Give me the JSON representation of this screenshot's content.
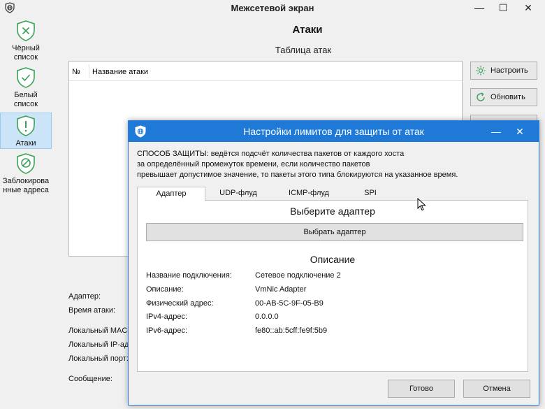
{
  "window": {
    "title": "Межсетевой экран",
    "minimize": "—",
    "maximize": "☐",
    "close": "✕"
  },
  "nav": [
    {
      "line1": "Чёрный",
      "line2": "список",
      "icon": "shield-x-icon"
    },
    {
      "line1": "Белый",
      "line2": "список",
      "icon": "shield-check-icon"
    },
    {
      "line1": "Атаки",
      "line2": "",
      "icon": "shield-exclamation-icon",
      "active": true
    },
    {
      "line1": "Заблокирова",
      "line2": "нные адреса",
      "icon": "blocked-icon"
    }
  ],
  "page": {
    "title": "Атаки",
    "table_caption": "Таблица атак",
    "columns": [
      "№",
      "Название атаки"
    ],
    "buttons": {
      "configure": "Настроить",
      "refresh": "Обновить"
    },
    "info_labels": [
      "Адаптер:",
      "Время атаки:",
      "Локальный MAC-",
      "Локальный IP-ад",
      "Локальный порт:",
      "Сообщение:"
    ]
  },
  "dialog": {
    "title": "Настройки лимитов для защиты от атак",
    "minimize": "—",
    "close": "✕",
    "description_bold": "СПОСОБ ЗАЩИТЫ:",
    "description_line1": " ведётся подсчёт количества пакетов от каждого хоста",
    "description_line2": "за определённый промежуток времени, если количество пакетов",
    "description_line3": "превышает допустимое значение, то пакеты этого типа блокируются на указанное время.",
    "tabs": [
      "Адаптер",
      "UDP-флуд",
      "ICMP-флуд",
      "SPI"
    ],
    "active_tab": 0,
    "choose_title": "Выберите адаптер",
    "choose_button": "Выбрать адаптер",
    "desc_title": "Описание",
    "properties": [
      {
        "label": "Название подключения:",
        "value": "Сетевое подключение 2"
      },
      {
        "label": "Описание:",
        "value": "VmNic Adapter"
      },
      {
        "label": "Физический адрес:",
        "value": "00-AB-5C-9F-05-B9"
      },
      {
        "label": "IPv4-адрес:",
        "value": "0.0.0.0"
      },
      {
        "label": "IPv6-адрес:",
        "value": "fe80::ab:5cff:fe9f:5b9"
      }
    ],
    "ok_button": "Готово",
    "cancel_button": "Отмена"
  },
  "colors": {
    "dialog_titlebar": "#1e7ad6",
    "shield_green": "#3aa157",
    "nav_active": "#cce4f7"
  }
}
